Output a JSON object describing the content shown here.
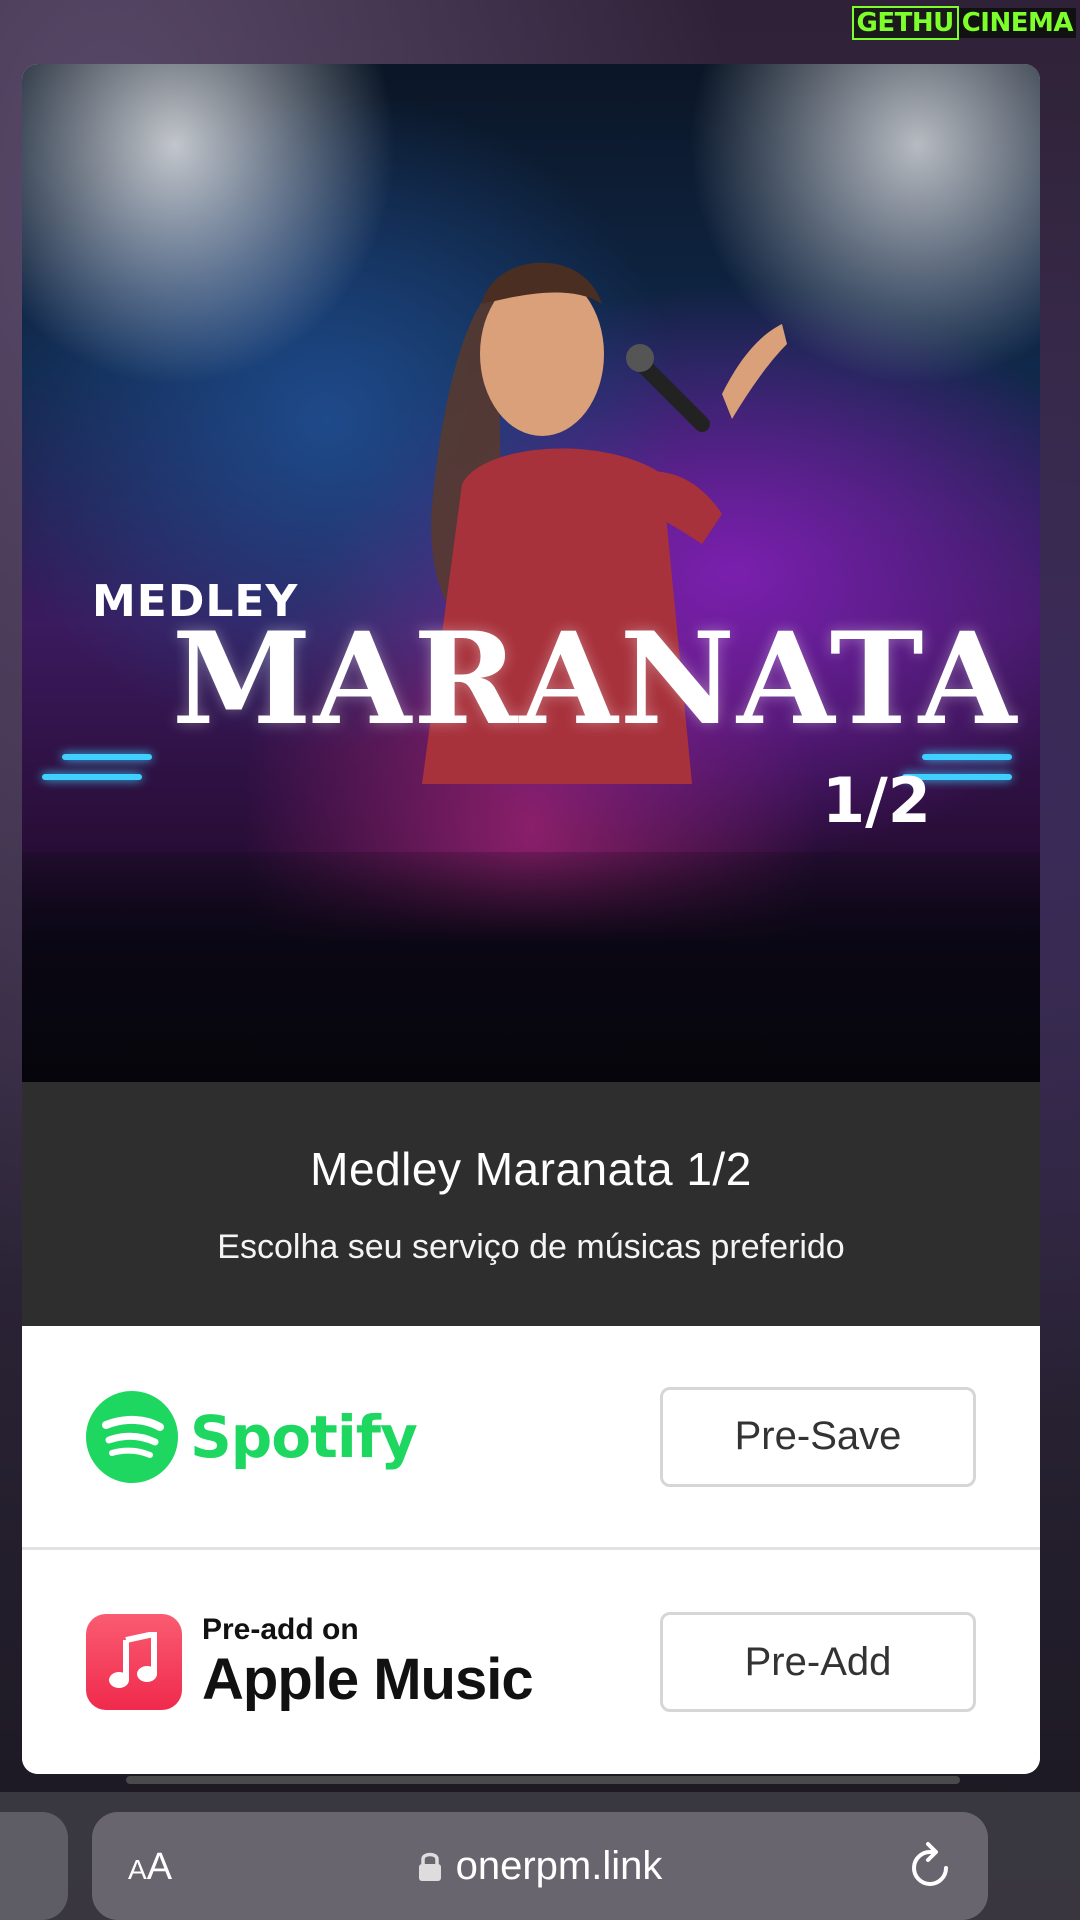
{
  "watermark": {
    "part1": "GETHU",
    "part2": "CINEMA"
  },
  "cover": {
    "line1": "MEDLEY",
    "line2": "MARANATA",
    "line3": "1/2"
  },
  "release": {
    "title": "Medley Maranata 1/2",
    "subtitle": "Escolha seu serviço de músicas preferido"
  },
  "services": [
    {
      "name": "Spotify",
      "logo_icon": "spotify-icon",
      "action_label": "Pre-Save",
      "color": "#1ed760"
    },
    {
      "name_small": "Pre-add on",
      "name": "Apple Music",
      "logo_icon": "apple-music-icon",
      "action_label": "Pre-Add",
      "color": "#f02a4c"
    }
  ],
  "browser": {
    "text_size_label_small": "A",
    "text_size_label_big": "A",
    "url": "onerpm.link",
    "icons": [
      "lock-icon",
      "reload-icon"
    ]
  }
}
